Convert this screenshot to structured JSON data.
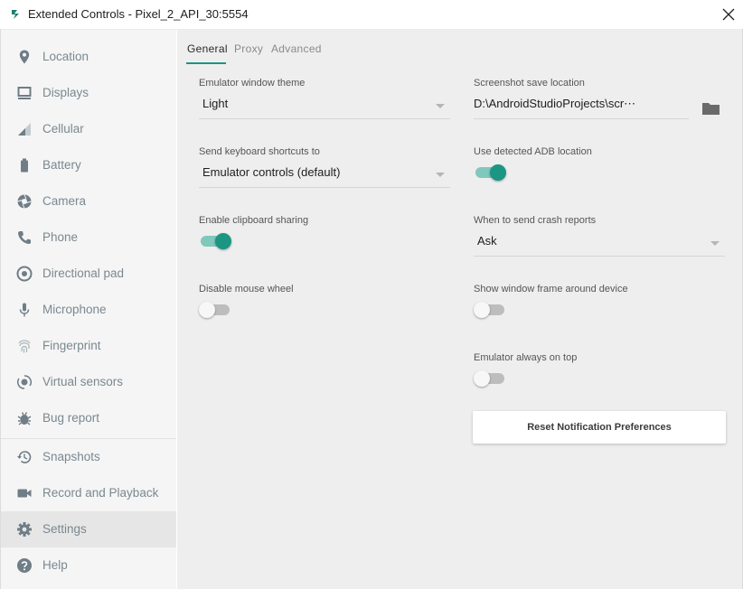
{
  "window": {
    "title": "Extended Controls - Pixel_2_API_30:5554"
  },
  "sidebar": {
    "items": [
      {
        "label": "Location",
        "icon": "location-pin-icon"
      },
      {
        "label": "Displays",
        "icon": "display-icon"
      },
      {
        "label": "Cellular",
        "icon": "signal-icon"
      },
      {
        "label": "Battery",
        "icon": "battery-icon"
      },
      {
        "label": "Camera",
        "icon": "camera-icon"
      },
      {
        "label": "Phone",
        "icon": "phone-icon"
      },
      {
        "label": "Directional pad",
        "icon": "dpad-icon"
      },
      {
        "label": "Microphone",
        "icon": "microphone-icon"
      },
      {
        "label": "Fingerprint",
        "icon": "fingerprint-icon"
      },
      {
        "label": "Virtual sensors",
        "icon": "sensors-icon"
      },
      {
        "label": "Bug report",
        "icon": "bug-icon"
      },
      {
        "label": "Snapshots",
        "icon": "history-icon"
      },
      {
        "label": "Record and Playback",
        "icon": "videocam-icon"
      },
      {
        "label": "Settings",
        "icon": "gear-icon",
        "active": true
      },
      {
        "label": "Help",
        "icon": "help-icon"
      }
    ]
  },
  "tabs": [
    {
      "label": "General",
      "active": true
    },
    {
      "label": "Proxy"
    },
    {
      "label": "Advanced"
    }
  ],
  "settings": {
    "theme": {
      "label": "Emulator window theme",
      "value": "Light"
    },
    "screenshot": {
      "label": "Screenshot save location",
      "value": "D:\\AndroidStudioProjects\\scr⋯"
    },
    "shortcuts": {
      "label": "Send keyboard shortcuts to",
      "value": "Emulator controls (default)"
    },
    "adb": {
      "label": "Use detected ADB location",
      "enabled": true
    },
    "clipboard": {
      "label": "Enable clipboard sharing",
      "enabled": true
    },
    "crash": {
      "label": "When to send crash reports",
      "value": "Ask"
    },
    "mouse_wheel": {
      "label": "Disable mouse wheel",
      "enabled": false
    },
    "window_frame": {
      "label": "Show window frame around device",
      "enabled": false
    },
    "always_on_top": {
      "label": "Emulator always on top",
      "enabled": false
    },
    "reset_button": "Reset Notification Preferences"
  },
  "colors": {
    "accent": "#1a9683",
    "sidebar_text": "#7a8890",
    "sidebar_icon": "#6f7d86"
  }
}
